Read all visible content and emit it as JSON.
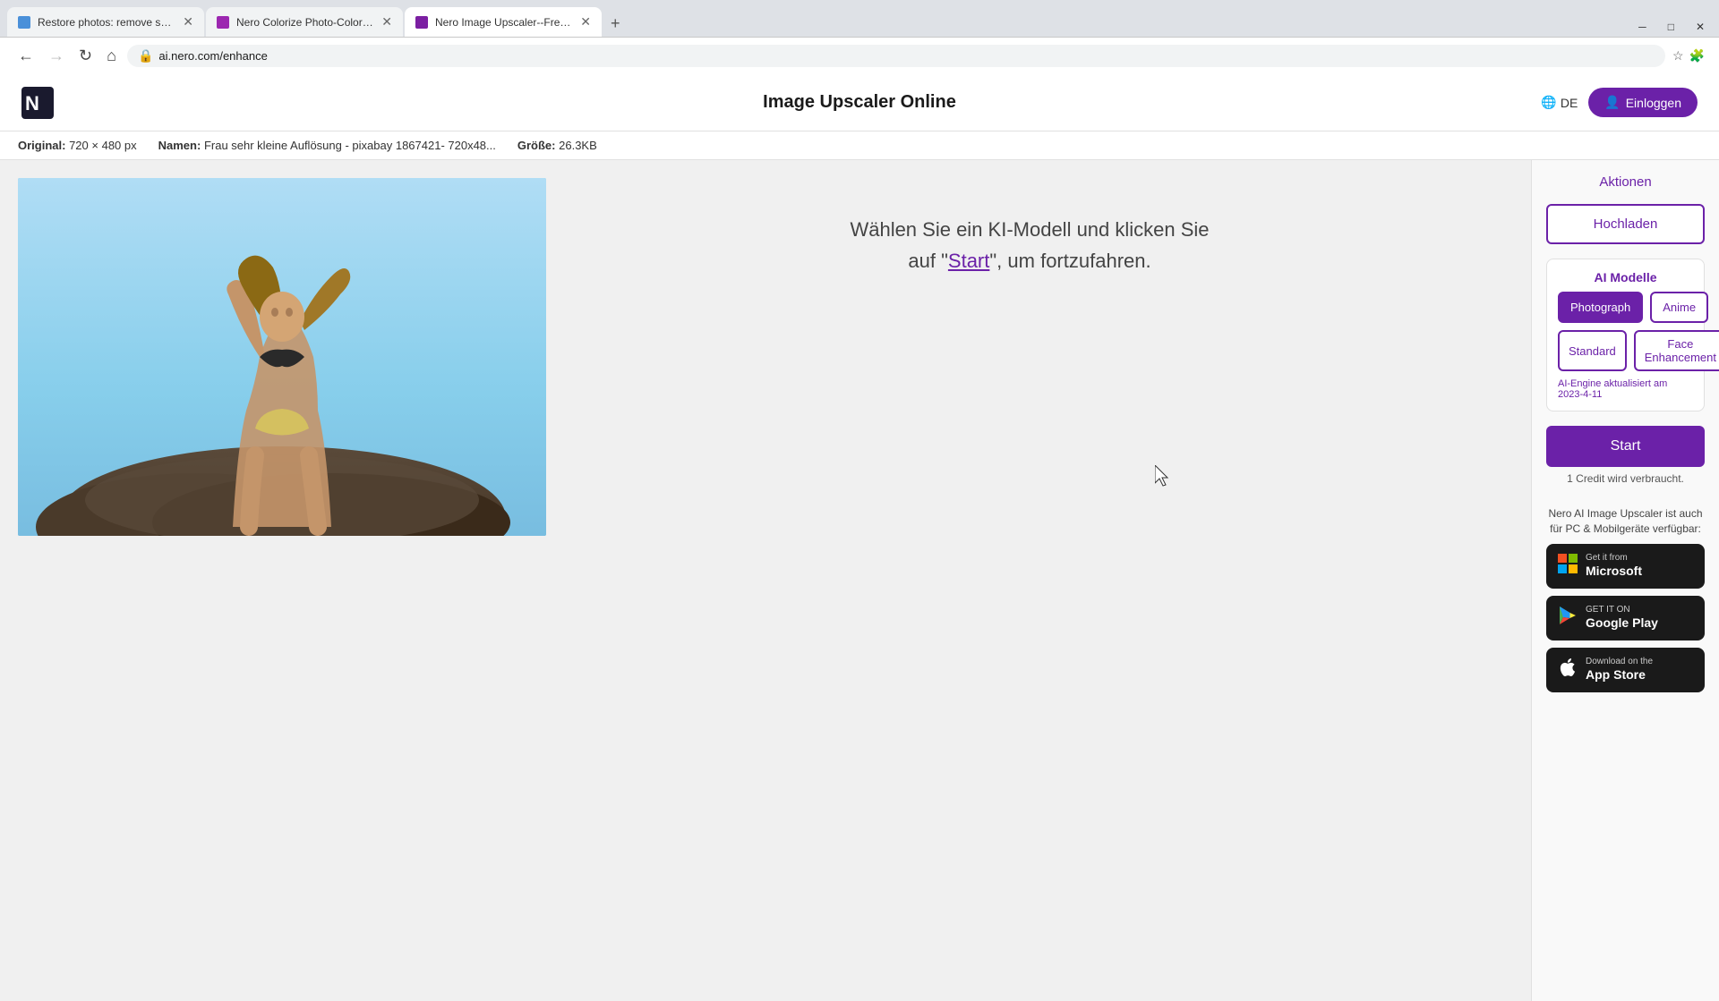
{
  "browser": {
    "tabs": [
      {
        "id": "tab1",
        "label": "Restore photos: remove scratch...",
        "favicon_color": "#4a90d9",
        "active": false
      },
      {
        "id": "tab2",
        "label": "Nero Colorize Photo-Colorize Yo...",
        "favicon_color": "#9c27b0",
        "active": false
      },
      {
        "id": "tab3",
        "label": "Nero Image Upscaler--Free Pho...",
        "favicon_color": "#7b1fa2",
        "active": true
      }
    ],
    "url": "ai.nero.com/enhance"
  },
  "header": {
    "title": "Image Upscaler Online",
    "lang_label": "DE",
    "login_label": "Einloggen"
  },
  "info_bar": {
    "original_label": "Original:",
    "original_value": "720 × 480 px",
    "name_label": "Namen:",
    "name_value": "Frau sehr kleine Auflösung - pixabay 1867421- 720x48...",
    "size_label": "Größe:",
    "size_value": "26.3KB"
  },
  "instruction": {
    "text_part1": "Wählen Sie ein KI-Modell und klicken Sie",
    "text_part2": "auf \"Start\", um fortzufahren.",
    "start_link": "Start"
  },
  "sidebar": {
    "aktionen_title": "Aktionen",
    "upload_label": "Hochladen",
    "ai_models_title": "AI Modelle",
    "model_buttons": [
      {
        "label": "Photograph",
        "active": true
      },
      {
        "label": "Anime",
        "active": false
      }
    ],
    "enhancement_buttons": [
      {
        "label": "Standard",
        "active": false
      },
      {
        "label": "Face Enhancement",
        "active": false
      }
    ],
    "engine_text": "AI-Engine aktualisiert am 2023-4-11",
    "start_label": "Start",
    "credit_text": "1 Credit wird verbraucht.",
    "apps_promo": "Nero AI Image Upscaler ist auch für PC & Mobilgeräte verfügbar:",
    "store_buttons": [
      {
        "sub": "Get it from",
        "name": "Microsoft",
        "icon": "⊞"
      },
      {
        "sub": "GET IT ON",
        "name": "Google Play",
        "icon": "▶"
      },
      {
        "sub": "Download on the",
        "name": "App Store",
        "icon": ""
      }
    ]
  }
}
